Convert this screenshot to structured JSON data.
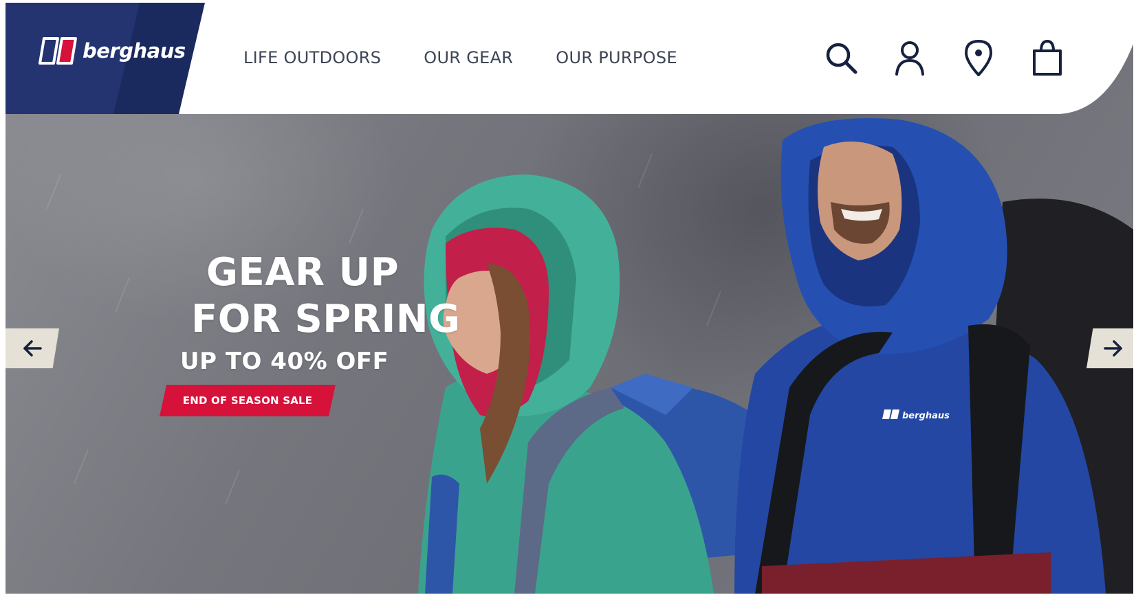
{
  "brand": {
    "name": "berghaus",
    "colors": {
      "navy": "#1b2a5e",
      "red": "#d6123a",
      "white": "#ffffff"
    }
  },
  "nav": {
    "items": [
      {
        "label": "LIFE OUTDOORS"
      },
      {
        "label": "OUR GEAR"
      },
      {
        "label": "OUR PURPOSE"
      }
    ]
  },
  "header_icons": [
    "search-icon",
    "account-icon",
    "store-locator-icon",
    "shopping-bag-icon"
  ],
  "hero": {
    "headline_line1": "GEAR UP",
    "headline_line2": "FOR SPRING",
    "subline": "UP TO 40% OFF",
    "cta_label": "END OF SEASON SALE",
    "prev_icon": "arrow-left-icon",
    "next_icon": "arrow-right-icon",
    "jacket_logo": "berghaus"
  }
}
